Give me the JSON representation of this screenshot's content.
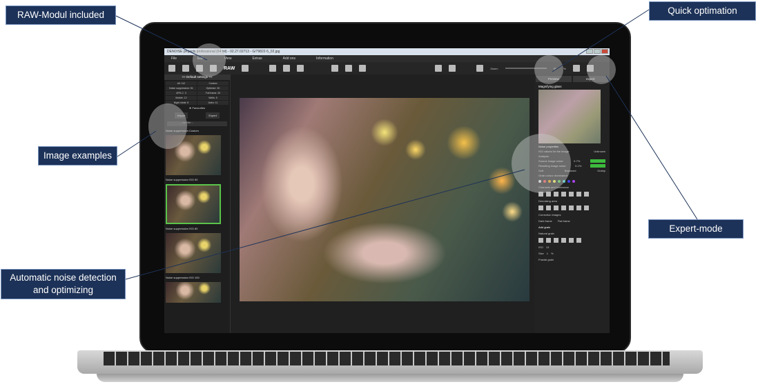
{
  "callouts": {
    "raw_modul": "RAW-Modul included",
    "image_examples": "Image examples",
    "auto_noise": "Automatic noise detection and optimizing",
    "quick_opt": "Quick optimation",
    "expert_mode": "Expert-mode"
  },
  "app": {
    "title": "DENOISE projects professional (64 bit) - 02.27.02713 - G/79822-5_02.jpg",
    "menu": [
      "File",
      "Edit",
      "View",
      "Extras",
      "Add ons",
      "Information"
    ],
    "raw_label": "RAW",
    "zoom_label": "Zoom:",
    "zoom_value": "90",
    "zoom_unit": "%"
  },
  "left_panel": {
    "header": ">> Default settings <<",
    "presets": [
      "All: 112",
      "Custom",
      "Noise suppression: 51",
      "Optimize: 30",
      "APS-C: 3",
      "Full frame: 20",
      "Mobile: 12",
      "Wells: 5",
      "Night shots: 8",
      "Astro: 11"
    ],
    "favourites": "Favourites",
    "import": "Import",
    "expert": "Expert",
    "filter": "-- no filter --",
    "sections": [
      "Noise suppression Custom",
      "Noise suppression ISO 50",
      "Noise suppression ISO 80",
      "Noise suppression ISO 100"
    ]
  },
  "right_panel": {
    "tab_preview": "Preview",
    "tab_expert": "expert",
    "magnifier": "Magnifying glass",
    "noise_properties": "Noise properties",
    "iso_label": "ISO values for the image:",
    "iso_value": "Unknown",
    "analysis": "Analysis",
    "source_noise": "Source image noise:",
    "source_pct": "0.7%",
    "result_noise": "Resulting image noise:",
    "result_pct": "0.1%",
    "modes": [
      "Soft",
      "Balanced",
      "Grainy"
    ],
    "grain_colour": "Grain colour dominance",
    "channels": "Channels and luminance",
    "denoising_area": "Denoising area",
    "correction": "Correction images",
    "dark_frame": "Dark frame",
    "flat_frame": "Flat frame",
    "add_grain": "Add grain",
    "natural_grain": "Natural grain",
    "iso_grain_label": "ISO",
    "iso_grain_value": "13",
    "size_label": "Size",
    "size_value": "1",
    "size_unit": "%",
    "fractal_grain": "Fractal grain"
  },
  "colors": {
    "callout_bg": "#1d3258",
    "accent_green": "#5ac44a"
  }
}
